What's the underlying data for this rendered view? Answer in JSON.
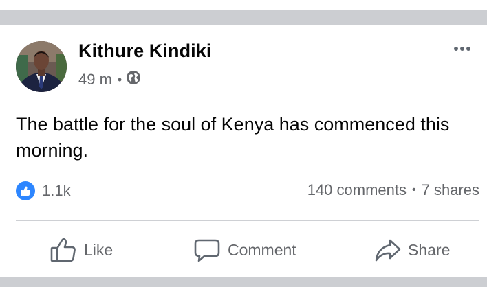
{
  "post": {
    "author": "Kithure Kindiki",
    "time": "49 m",
    "meta_separator": "•",
    "privacy_icon": "globe-icon",
    "text": "The battle for the soul of Kenya has commenced this morning.",
    "reactions_count": "1.1k",
    "comments": "140 comments",
    "stats_separator": "•",
    "shares": "7 shares"
  },
  "actions": {
    "like_label": "Like",
    "comment_label": "Comment",
    "share_label": "Share"
  },
  "colors": {
    "accent": "#2d86ff",
    "secondary_text": "#65676b",
    "primary_text": "#050505",
    "separator_band": "#ccced2"
  }
}
